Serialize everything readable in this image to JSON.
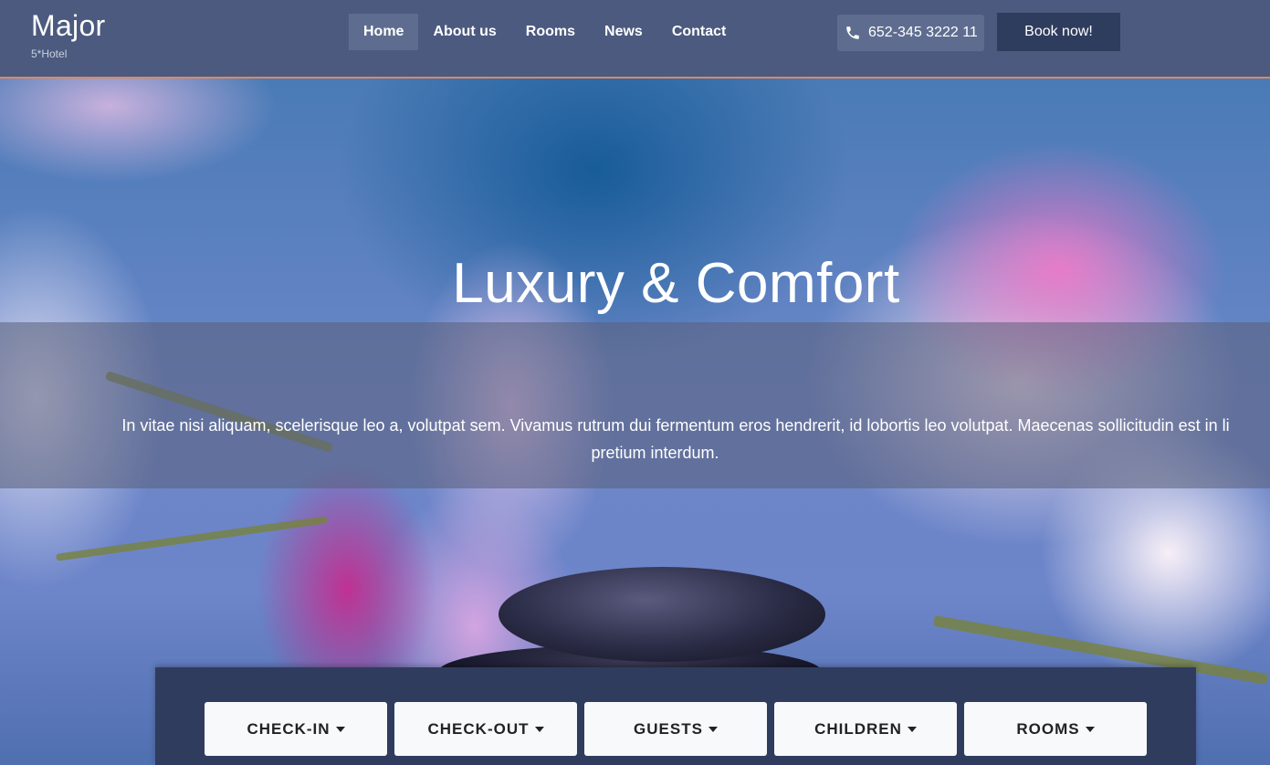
{
  "brand": {
    "name": "Major",
    "subtitle": "5*Hotel"
  },
  "nav": [
    {
      "label": "Home",
      "active": true
    },
    {
      "label": "About us",
      "active": false
    },
    {
      "label": "Rooms",
      "active": false
    },
    {
      "label": "News",
      "active": false
    },
    {
      "label": "Contact",
      "active": false
    }
  ],
  "phone": {
    "icon": "phone-icon",
    "number": "652-345 3222 11"
  },
  "book_button": "Book now!",
  "hero": {
    "title": "Luxury & Comfort",
    "text_line1": "In vitae nisi aliquam, scelerisque leo a, volutpat sem. Vivamus rutrum dui fermentum eros hendrerit, id lobortis leo volutpat. Maecenas sollicitudin est in li",
    "text_line2": "pretium interdum."
  },
  "booking": {
    "items": [
      "CHECK-IN",
      "CHECK-OUT",
      "GUESTS",
      "CHILDREN",
      "ROOMS"
    ]
  },
  "colors": {
    "navbar": "#4b5a7e",
    "accent_border": "#e0885a",
    "book_button": "#2e3c5e",
    "booking_panel": "#2f3c5e"
  }
}
